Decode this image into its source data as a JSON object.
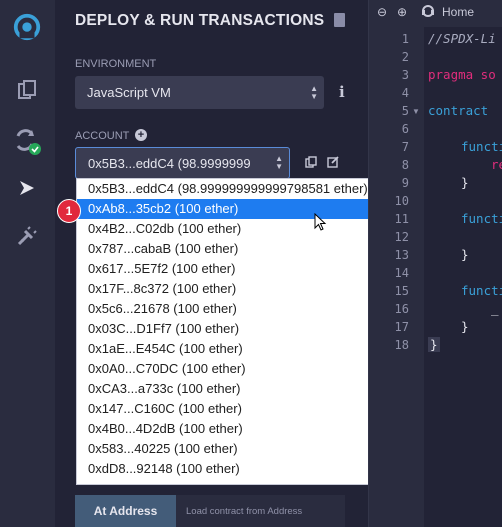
{
  "panel": {
    "title": "DEPLOY & RUN TRANSACTIONS",
    "environment_label": "ENVIRONMENT",
    "environment_value": "JavaScript VM",
    "account_label": "ACCOUNT",
    "account_value": "0x5B3...eddC4 (98.9999999",
    "at_address_button": "At Address",
    "at_address_placeholder": "Load contract from Address"
  },
  "account_options": [
    "0x5B3...eddC4 (98.999999999999798581 ether)",
    "0xAb8...35cb2 (100 ether)",
    "0x4B2...C02db (100 ether)",
    "0x787...cabaB (100 ether)",
    "0x617...5E7f2 (100 ether)",
    "0x17F...8c372 (100 ether)",
    "0x5c6...21678 (100 ether)",
    "0x03C...D1Ff7 (100 ether)",
    "0x1aE...E454C (100 ether)",
    "0x0A0...C70DC (100 ether)",
    "0xCA3...a733c (100 ether)",
    "0x147...C160C (100 ether)",
    "0x4B0...4D2dB (100 ether)",
    "0x583...40225 (100 ether)",
    "0xdD8...92148 (100 ether)"
  ],
  "selected_option_index": 1,
  "annotation_badge": "1",
  "editor": {
    "home_tab": "Home",
    "line_numbers": [
      "1",
      "2",
      "3",
      "4",
      "5",
      "6",
      "7",
      "8",
      "9",
      "10",
      "11",
      "12",
      "13",
      "14",
      "15",
      "16",
      "17",
      "18"
    ],
    "code_lines": [
      "//SPDX-Li",
      "pragma so",
      "contract",
      "functi",
      "re",
      "}",
      "functi",
      "}",
      "functi",
      "_",
      "}",
      "}"
    ]
  },
  "colors": {
    "background": "#222336",
    "sidebar": "#2a2c3f",
    "selected_option": "#1e7cf0",
    "badge": "#e1283c",
    "keyword": "#e02d7c",
    "comment": "#a9acc0"
  }
}
